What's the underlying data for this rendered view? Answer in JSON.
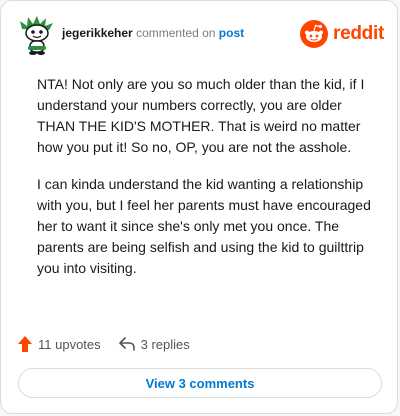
{
  "comment": {
    "username": "jegerikkeher",
    "action_text": "commented on",
    "target_link": "post",
    "paragraphs": [
      "NTA! Not only are you so much older than the kid, if I understand your numbers correctly, you are older THAN THE KID'S MOTHER. That is weird no matter how you put it! So no, OP, you are not the asshole.",
      "I can kinda understand the kid wanting a relationship with you, but I feel her parents must have encouraged her to want it since she's only met you once. The parents are being selfish and using the kid to guilttrip you into visiting."
    ]
  },
  "brand": {
    "name": "reddit",
    "color": "#ff4500",
    "icon": "reddit-alien-icon"
  },
  "actions": {
    "upvotes_label": "11 upvotes",
    "replies_label": "3 replies",
    "upvote_icon": "upvote-arrow-icon",
    "reply_icon": "reply-arrow-icon"
  },
  "footer": {
    "view_comments_label": "View 3 comments"
  },
  "colors": {
    "accent_blue": "#0079d3",
    "upvote_orange": "#ff4500",
    "text": "#1a1a1b"
  }
}
